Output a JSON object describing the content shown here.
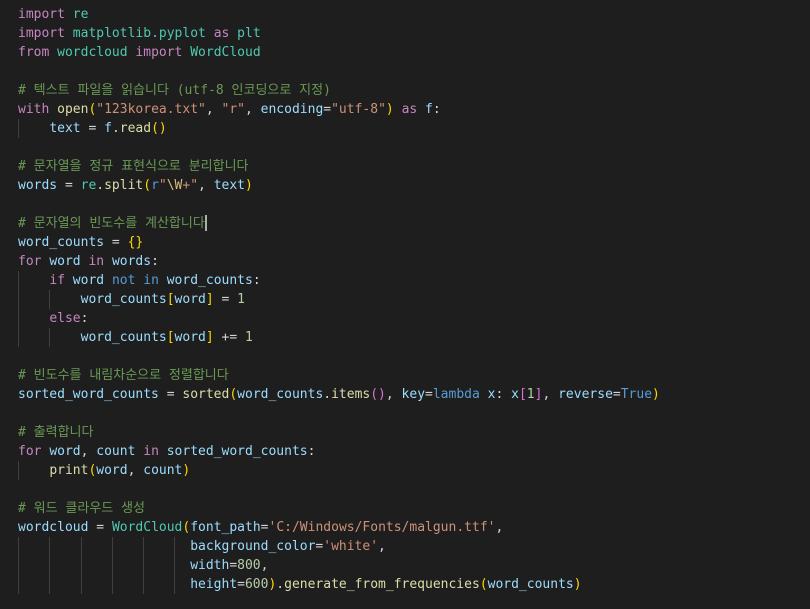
{
  "code_lines": [
    [
      [
        "kw",
        "import"
      ],
      [
        "tx",
        " "
      ],
      [
        "cl",
        "re"
      ]
    ],
    [
      [
        "kw",
        "import"
      ],
      [
        "tx",
        " "
      ],
      [
        "cl",
        "matplotlib.pyplot"
      ],
      [
        "tx",
        " "
      ],
      [
        "kw",
        "as"
      ],
      [
        "tx",
        " "
      ],
      [
        "cl",
        "plt"
      ]
    ],
    [
      [
        "kw",
        "from"
      ],
      [
        "tx",
        " "
      ],
      [
        "cl",
        "wordcloud"
      ],
      [
        "tx",
        " "
      ],
      [
        "kw",
        "import"
      ],
      [
        "tx",
        " "
      ],
      [
        "cl",
        "WordCloud"
      ]
    ],
    [],
    [
      [
        "cm",
        "# 텍스트 파일을 읽습니다 (utf-8 인코딩으로 지정)"
      ]
    ],
    [
      [
        "kw",
        "with"
      ],
      [
        "tx",
        " "
      ],
      [
        "fn",
        "open"
      ],
      [
        "b1",
        "("
      ],
      [
        "st",
        "\"123korea.txt\""
      ],
      [
        "tx",
        ", "
      ],
      [
        "st",
        "\"r\""
      ],
      [
        "tx",
        ", "
      ],
      [
        "vr",
        "encoding"
      ],
      [
        "op",
        "="
      ],
      [
        "st",
        "\"utf-8\""
      ],
      [
        "b1",
        ")"
      ],
      [
        "tx",
        " "
      ],
      [
        "kw",
        "as"
      ],
      [
        "tx",
        " "
      ],
      [
        "vr",
        "f"
      ],
      [
        "tx",
        ":"
      ]
    ],
    [
      [
        "tx",
        "    "
      ],
      [
        "vr",
        "text"
      ],
      [
        "tx",
        " "
      ],
      [
        "op",
        "="
      ],
      [
        "tx",
        " "
      ],
      [
        "vr",
        "f"
      ],
      [
        "tx",
        "."
      ],
      [
        "fn",
        "read"
      ],
      [
        "b1",
        "()"
      ]
    ],
    [],
    [
      [
        "cm",
        "# 문자열을 정규 표현식으로 분리합니다"
      ]
    ],
    [
      [
        "vr",
        "words"
      ],
      [
        "tx",
        " "
      ],
      [
        "op",
        "="
      ],
      [
        "tx",
        " "
      ],
      [
        "cl",
        "re"
      ],
      [
        "tx",
        "."
      ],
      [
        "fn",
        "split"
      ],
      [
        "b1",
        "("
      ],
      [
        "kb",
        "r"
      ],
      [
        "st",
        "\""
      ],
      [
        "esc",
        "\\W"
      ],
      [
        "st",
        "+\""
      ],
      [
        "tx",
        ", "
      ],
      [
        "vr",
        "text"
      ],
      [
        "b1",
        ")"
      ]
    ],
    [],
    [
      [
        "cm",
        "# 문자열의 빈도수를 계산합니다"
      ],
      [
        "caret",
        ""
      ]
    ],
    [
      [
        "vr",
        "word_counts"
      ],
      [
        "tx",
        " "
      ],
      [
        "op",
        "="
      ],
      [
        "tx",
        " "
      ],
      [
        "b1",
        "{}"
      ]
    ],
    [
      [
        "kw",
        "for"
      ],
      [
        "tx",
        " "
      ],
      [
        "vr",
        "word"
      ],
      [
        "tx",
        " "
      ],
      [
        "kw",
        "in"
      ],
      [
        "tx",
        " "
      ],
      [
        "vr",
        "words"
      ],
      [
        "tx",
        ":"
      ]
    ],
    [
      [
        "tx",
        "    "
      ],
      [
        "kw",
        "if"
      ],
      [
        "tx",
        " "
      ],
      [
        "vr",
        "word"
      ],
      [
        "tx",
        " "
      ],
      [
        "kb",
        "not"
      ],
      [
        "tx",
        " "
      ],
      [
        "kb",
        "in"
      ],
      [
        "tx",
        " "
      ],
      [
        "vr",
        "word_counts"
      ],
      [
        "tx",
        ":"
      ]
    ],
    [
      [
        "tx",
        "        "
      ],
      [
        "vr",
        "word_counts"
      ],
      [
        "b1",
        "["
      ],
      [
        "vr",
        "word"
      ],
      [
        "b1",
        "]"
      ],
      [
        "tx",
        " "
      ],
      [
        "op",
        "="
      ],
      [
        "tx",
        " "
      ],
      [
        "nm",
        "1"
      ]
    ],
    [
      [
        "tx",
        "    "
      ],
      [
        "kw",
        "else"
      ],
      [
        "tx",
        ":"
      ]
    ],
    [
      [
        "tx",
        "        "
      ],
      [
        "vr",
        "word_counts"
      ],
      [
        "b1",
        "["
      ],
      [
        "vr",
        "word"
      ],
      [
        "b1",
        "]"
      ],
      [
        "tx",
        " "
      ],
      [
        "op",
        "+="
      ],
      [
        "tx",
        " "
      ],
      [
        "nm",
        "1"
      ]
    ],
    [],
    [
      [
        "cm",
        "# 빈도수를 내림차순으로 정렬합니다"
      ]
    ],
    [
      [
        "vr",
        "sorted_word_counts"
      ],
      [
        "tx",
        " "
      ],
      [
        "op",
        "="
      ],
      [
        "tx",
        " "
      ],
      [
        "fn",
        "sorted"
      ],
      [
        "b1",
        "("
      ],
      [
        "vr",
        "word_counts"
      ],
      [
        "tx",
        "."
      ],
      [
        "fn",
        "items"
      ],
      [
        "b2",
        "()"
      ],
      [
        "tx",
        ", "
      ],
      [
        "vr",
        "key"
      ],
      [
        "op",
        "="
      ],
      [
        "kb",
        "lambda"
      ],
      [
        "tx",
        " "
      ],
      [
        "vr",
        "x"
      ],
      [
        "tx",
        ": "
      ],
      [
        "vr",
        "x"
      ],
      [
        "b2",
        "["
      ],
      [
        "nm",
        "1"
      ],
      [
        "b2",
        "]"
      ],
      [
        "tx",
        ", "
      ],
      [
        "vr",
        "reverse"
      ],
      [
        "op",
        "="
      ],
      [
        "kb",
        "True"
      ],
      [
        "b1",
        ")"
      ]
    ],
    [],
    [
      [
        "cm",
        "# 출력합니다"
      ]
    ],
    [
      [
        "kw",
        "for"
      ],
      [
        "tx",
        " "
      ],
      [
        "vr",
        "word"
      ],
      [
        "tx",
        ", "
      ],
      [
        "vr",
        "count"
      ],
      [
        "tx",
        " "
      ],
      [
        "kw",
        "in"
      ],
      [
        "tx",
        " "
      ],
      [
        "vr",
        "sorted_word_counts"
      ],
      [
        "tx",
        ":"
      ]
    ],
    [
      [
        "tx",
        "    "
      ],
      [
        "fn",
        "print"
      ],
      [
        "b1",
        "("
      ],
      [
        "vr",
        "word"
      ],
      [
        "tx",
        ", "
      ],
      [
        "vr",
        "count"
      ],
      [
        "b1",
        ")"
      ]
    ],
    [],
    [
      [
        "cm",
        "# 워드 클라우드 생성"
      ]
    ],
    [
      [
        "vr",
        "wordcloud"
      ],
      [
        "tx",
        " "
      ],
      [
        "op",
        "="
      ],
      [
        "tx",
        " "
      ],
      [
        "cl",
        "WordCloud"
      ],
      [
        "b1",
        "("
      ],
      [
        "vr",
        "font_path"
      ],
      [
        "op",
        "="
      ],
      [
        "st",
        "'C:/Windows/Fonts/malgun.ttf'"
      ],
      [
        "tx",
        ","
      ]
    ],
    [
      [
        "tx",
        "                      "
      ],
      [
        "vr",
        "background_color"
      ],
      [
        "op",
        "="
      ],
      [
        "st",
        "'white'"
      ],
      [
        "tx",
        ","
      ]
    ],
    [
      [
        "tx",
        "                      "
      ],
      [
        "vr",
        "width"
      ],
      [
        "op",
        "="
      ],
      [
        "nm",
        "800"
      ],
      [
        "tx",
        ","
      ]
    ],
    [
      [
        "tx",
        "                      "
      ],
      [
        "vr",
        "height"
      ],
      [
        "op",
        "="
      ],
      [
        "nm",
        "600"
      ],
      [
        "b1",
        ")"
      ],
      [
        "tx",
        "."
      ],
      [
        "fn",
        "generate_from_frequencies"
      ],
      [
        "b1",
        "("
      ],
      [
        "vr",
        "word_counts"
      ],
      [
        "b1",
        ")"
      ]
    ]
  ],
  "colors": {
    "background": "#1e1e1e",
    "keyword_control": "#c586c0",
    "keyword": "#569cd6",
    "function": "#dcdcaa",
    "variable": "#9cdcfe",
    "string": "#ce9178",
    "number": "#b5cea8",
    "comment": "#6a9955",
    "class": "#4ec9b0"
  }
}
